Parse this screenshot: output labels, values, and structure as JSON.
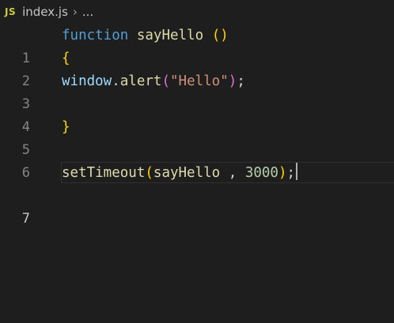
{
  "breadcrumb": {
    "lang_badge": "JS",
    "filename": "index.js",
    "separator": "›",
    "ellipsis": "..."
  },
  "editor": {
    "lines": [
      {
        "number": "1",
        "tokens": {
          "t1": "function",
          "t2": " ",
          "t3": "sayHello",
          "t4": " ",
          "t5": "()"
        }
      },
      {
        "number": "2",
        "tokens": {
          "t1": "{"
        }
      },
      {
        "number": "3",
        "tokens": {
          "t1": "window",
          "t2": ".",
          "t3": "alert",
          "t4": "(",
          "t5": "\"Hello\"",
          "t6": ")",
          "t7": ";"
        }
      },
      {
        "number": "4",
        "tokens": {}
      },
      {
        "number": "5",
        "tokens": {
          "t1": "}"
        }
      },
      {
        "number": "6",
        "tokens": {}
      },
      {
        "number": "7",
        "tokens": {
          "t1": "setTimeout",
          "t2": "(",
          "t3": "sayHello",
          "t4": " , ",
          "t5": "3000",
          "t6": ")",
          "t7": ";"
        }
      }
    ],
    "active_line": "7"
  },
  "colors": {
    "background": "#1e1e1e",
    "keyword": "#569cd6",
    "function": "#dcdcaa",
    "bracket": "#ffd700",
    "bracket_nested": "#da70d6",
    "variable": "#9cdcfe",
    "string": "#ce9178",
    "number": "#b5cea8"
  }
}
